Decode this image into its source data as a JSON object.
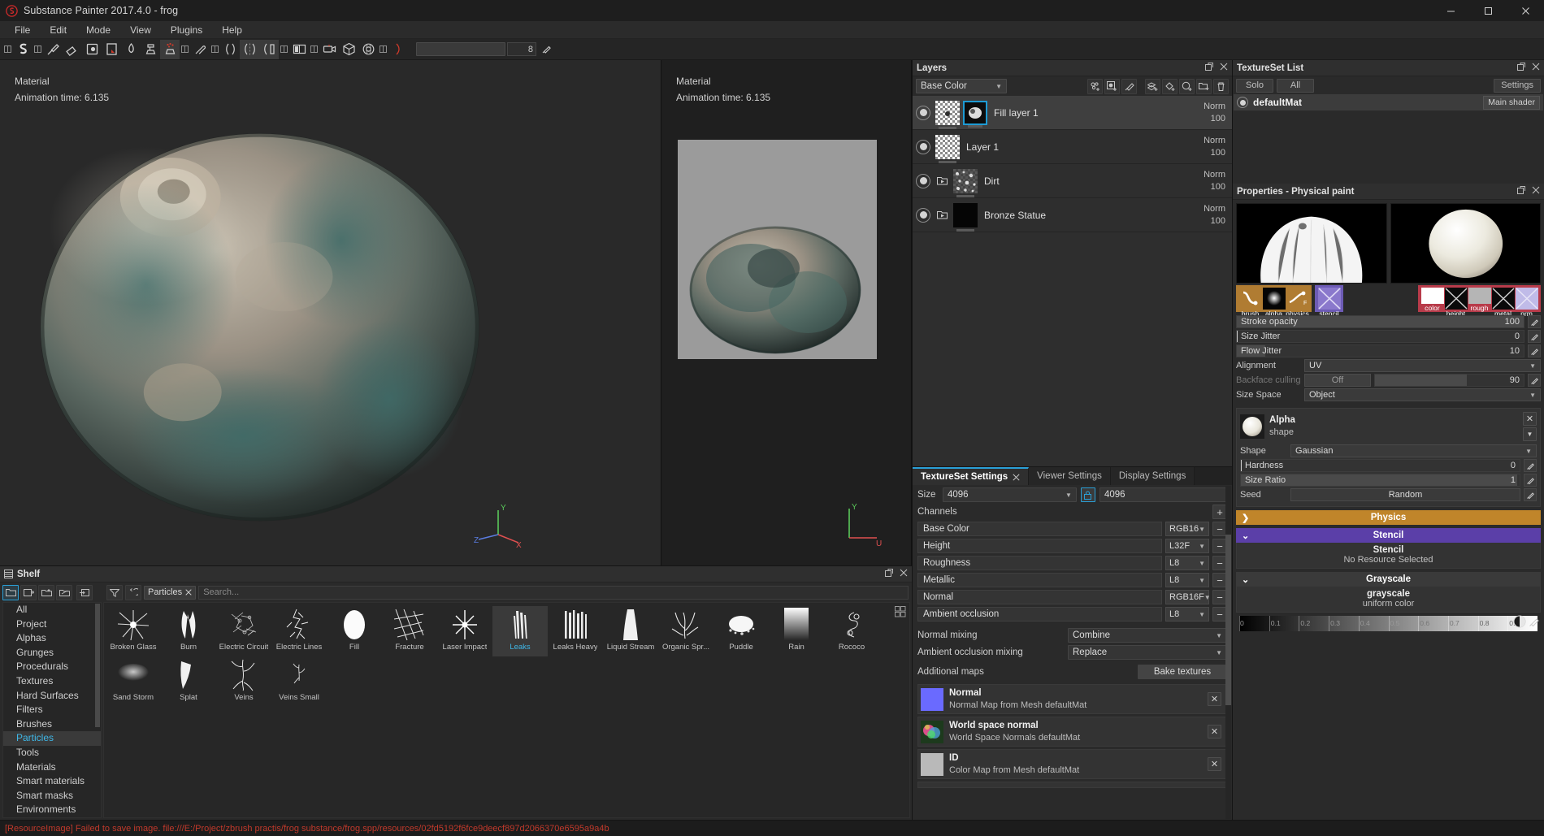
{
  "titlebar": {
    "title": "Substance Painter 2017.4.0 - frog",
    "logo": "substance-logo-icon"
  },
  "menubar": {
    "items": [
      "File",
      "Edit",
      "Mode",
      "View",
      "Plugins",
      "Help"
    ]
  },
  "toolbar": {
    "brush_size_value": "8"
  },
  "viewport_3d": {
    "label": "Material",
    "anim_label": "Animation time: 6.135"
  },
  "viewport_2d": {
    "label": "Material",
    "anim_label": "Animation time: 6.135"
  },
  "shelf": {
    "title": "Shelf",
    "categories": [
      "All",
      "Project",
      "Alphas",
      "Grunges",
      "Procedurals",
      "Textures",
      "Hard Surfaces",
      "Filters",
      "Brushes",
      "Particles",
      "Tools",
      "Materials",
      "Smart materials",
      "Smart masks",
      "Environments"
    ],
    "selected_category": "Particles",
    "filter_chip": "Particles",
    "search_placeholder": "Search...",
    "items": [
      {
        "label": "Broken Glass",
        "selected": false
      },
      {
        "label": "Burn",
        "selected": false
      },
      {
        "label": "Electric Circuit",
        "selected": false
      },
      {
        "label": "Electric Lines",
        "selected": false
      },
      {
        "label": "Fill",
        "selected": false
      },
      {
        "label": "Fracture",
        "selected": false
      },
      {
        "label": "Laser Impact",
        "selected": false
      },
      {
        "label": "Leaks",
        "selected": true
      },
      {
        "label": "Leaks Heavy",
        "selected": false
      },
      {
        "label": "Liquid Stream",
        "selected": false
      },
      {
        "label": "Organic Spr...",
        "selected": false
      },
      {
        "label": "Puddle",
        "selected": false
      },
      {
        "label": "Rain",
        "selected": false
      },
      {
        "label": "Rococo",
        "selected": false
      },
      {
        "label": "Sand Storm",
        "selected": false
      },
      {
        "label": "Splat",
        "selected": false
      },
      {
        "label": "Veins",
        "selected": false
      },
      {
        "label": "Veins Small",
        "selected": false
      }
    ]
  },
  "layers": {
    "title": "Layers",
    "channel_selector": "Base Color",
    "rows": [
      {
        "name": "Fill layer 1",
        "blend": "Norm",
        "opacity": "100",
        "selected": true,
        "has_mask": true,
        "is_group": false,
        "thumb": "checker"
      },
      {
        "name": "Layer 1",
        "blend": "Norm",
        "opacity": "100",
        "selected": false,
        "has_mask": false,
        "is_group": false,
        "thumb": "checker"
      },
      {
        "name": "Dirt",
        "blend": "Norm",
        "opacity": "100",
        "selected": false,
        "has_mask": false,
        "is_group": true,
        "thumb": "noise"
      },
      {
        "name": "Bronze Statue",
        "blend": "Norm",
        "opacity": "100",
        "selected": false,
        "has_mask": false,
        "is_group": true,
        "thumb": "black"
      }
    ]
  },
  "textureset_settings": {
    "tabs": [
      {
        "label": "TextureSet Settings",
        "active": true,
        "closable": true
      },
      {
        "label": "Viewer Settings",
        "active": false,
        "closable": false
      },
      {
        "label": "Display Settings",
        "active": false,
        "closable": false
      }
    ],
    "size_label": "Size",
    "size_value": "4096",
    "size_value2": "4096",
    "channels_label": "Channels",
    "channels": [
      {
        "name": "Base Color",
        "format": "RGB16"
      },
      {
        "name": "Height",
        "format": "L32F"
      },
      {
        "name": "Roughness",
        "format": "L8"
      },
      {
        "name": "Metallic",
        "format": "L8"
      },
      {
        "name": "Normal",
        "format": "RGB16F"
      },
      {
        "name": "Ambient occlusion",
        "format": "L8"
      }
    ],
    "normal_mixing_label": "Normal mixing",
    "normal_mixing_value": "Combine",
    "ao_mixing_label": "Ambient occlusion mixing",
    "ao_mixing_value": "Replace",
    "additional_maps_label": "Additional maps",
    "bake_button": "Bake textures",
    "maps": [
      {
        "title": "Normal",
        "sub": "Normal Map from Mesh defaultMat",
        "color": "#6a6aff"
      },
      {
        "title": "World space normal",
        "sub": "World Space Normals defaultMat",
        "color": "#5aa85a"
      },
      {
        "title": "ID",
        "sub": "Color Map from Mesh defaultMat",
        "color": "#b9b9b9"
      }
    ]
  },
  "textureset_list": {
    "title": "TextureSet List",
    "solo_label": "Solo",
    "all_label": "All",
    "settings_label": "Settings",
    "rows": [
      {
        "name": "defaultMat",
        "shader": "Main shader"
      }
    ]
  },
  "properties": {
    "title": "Properties - Physical paint",
    "brush_swatches": [
      {
        "cap": "brush",
        "group": "brown"
      },
      {
        "cap": "alpha",
        "group": "brown"
      },
      {
        "cap": "physics",
        "group": "brown"
      },
      {
        "cap": "stencil",
        "group": "purple"
      }
    ],
    "material_swatches": [
      {
        "cap": "color",
        "group": "red"
      },
      {
        "cap": "height",
        "group": "red"
      },
      {
        "cap": "rough",
        "group": "red"
      },
      {
        "cap": "metal",
        "group": "red"
      },
      {
        "cap": "nrm",
        "group": "red"
      }
    ],
    "params": [
      {
        "label": "Stroke opacity",
        "value": "100",
        "type": "slider",
        "fill": 100
      },
      {
        "label": "Size Jitter",
        "value": "0",
        "type": "slider",
        "fill": 0
      },
      {
        "label": "Flow Jitter",
        "value": "10",
        "type": "slider",
        "fill": 10
      }
    ],
    "alignment_label": "Alignment",
    "alignment_value": "UV",
    "backface_label": "Backface culling",
    "backface_value": "Off",
    "backface_number": "90",
    "size_space_label": "Size Space",
    "size_space_value": "Object",
    "alpha": {
      "title": "Alpha",
      "subtitle": "shape",
      "shape_label": "Shape",
      "shape_value": "Gaussian",
      "hardness_label": "Hardness",
      "hardness_value": "0",
      "size_ratio_label": "Size Ratio",
      "size_ratio_value": "1",
      "seed_label": "Seed",
      "seed_value": "Random"
    },
    "sections": [
      {
        "name": "Physics",
        "collapsed": true,
        "color": "#c0852a"
      },
      {
        "name": "Stencil",
        "collapsed": false,
        "color": "#5b3fa8",
        "body_title": "Stencil",
        "body_sub": "No Resource Selected"
      },
      {
        "name": "Grayscale",
        "collapsed": false,
        "color": "#3a3a3a",
        "body_title": "grayscale",
        "body_sub": "uniform color"
      }
    ],
    "gradient_ticks": [
      "0",
      "0.1",
      "0.2",
      "0.3",
      "0.4",
      "0.5",
      "0.6",
      "0.7",
      "0.8",
      "0.9"
    ]
  },
  "statusbar": {
    "message": "[ResourceImage] Failed to save image. file:///E:/Project/zbrush practis/frog substance/frog.spp/resources/02fd5192f6fce9deecf897d2066370e6595a9a4b"
  },
  "colors": {
    "accent": "#2a9fd6",
    "error": "#c0392b",
    "physics": "#c0852a",
    "stencil": "#5b3fa8"
  }
}
